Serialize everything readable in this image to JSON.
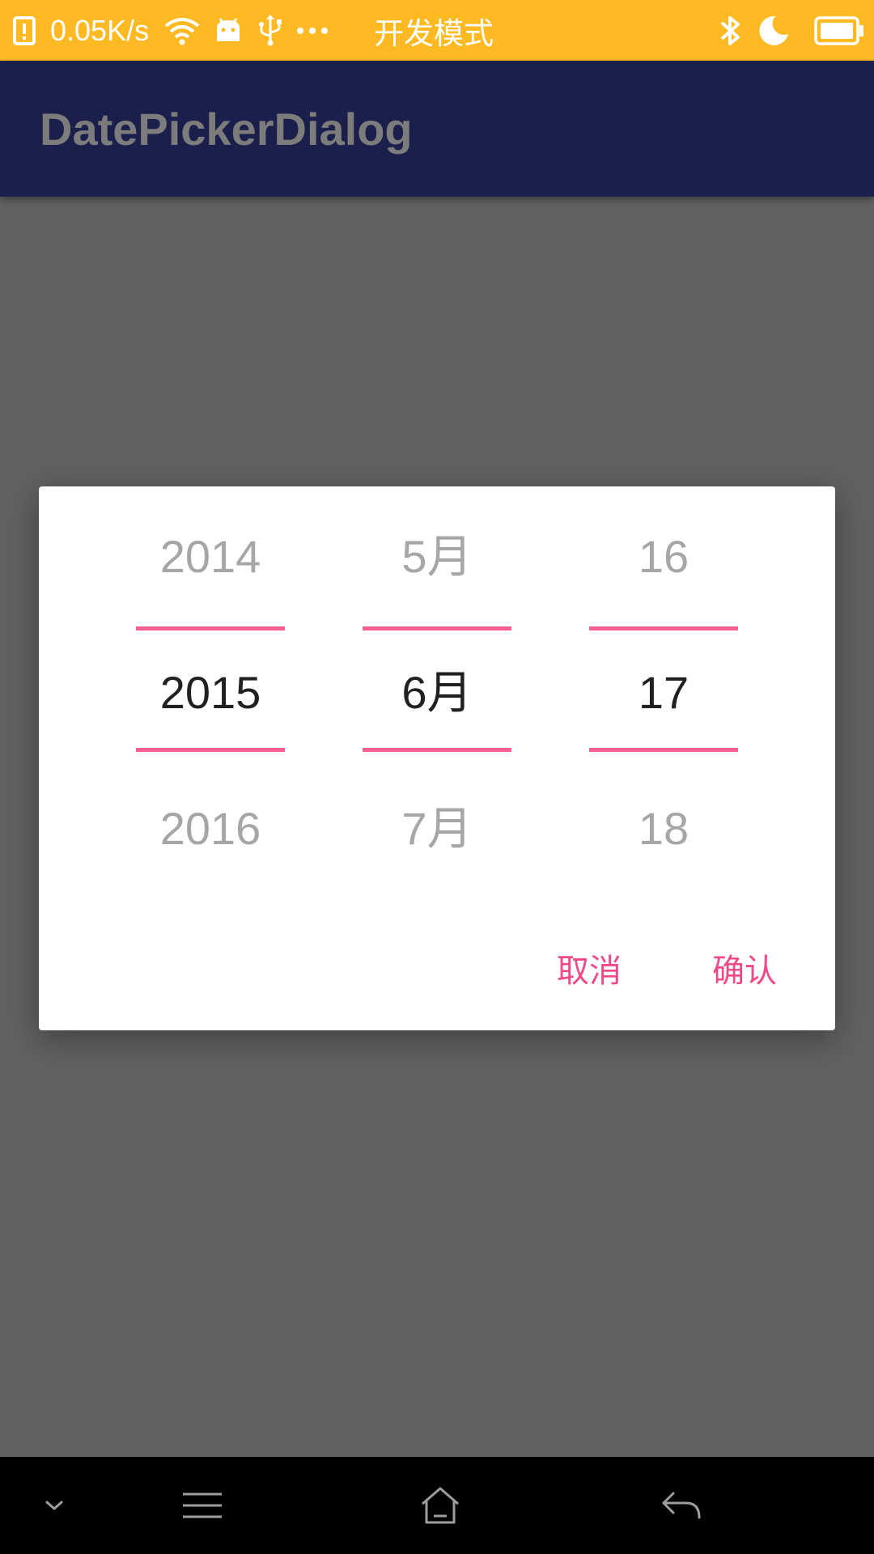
{
  "status_bar": {
    "speed": "0.05K/s",
    "mode_title": "开发模式",
    "icons": [
      "sim-icon",
      "wifi-icon",
      "android-icon",
      "usb-icon",
      "more-dots-icon",
      "bluetooth-icon",
      "moon-icon",
      "battery-icon"
    ],
    "background_color": "#FFB923"
  },
  "app_bar": {
    "title": "DatePickerDialog",
    "background_color": "#1A1F4B"
  },
  "dialog": {
    "year": {
      "prev": "2014",
      "current": "2015",
      "next": "2016"
    },
    "month": {
      "prev": "5月",
      "current": "6月",
      "next": "7月"
    },
    "day": {
      "prev": "16",
      "current": "17",
      "next": "18"
    },
    "cancel_label": "取消",
    "confirm_label": "确认",
    "accent_color": "#F25F90"
  },
  "nav_bar": {
    "icons": [
      "chevron-down-icon",
      "menu-icon",
      "home-icon",
      "back-icon"
    ]
  }
}
